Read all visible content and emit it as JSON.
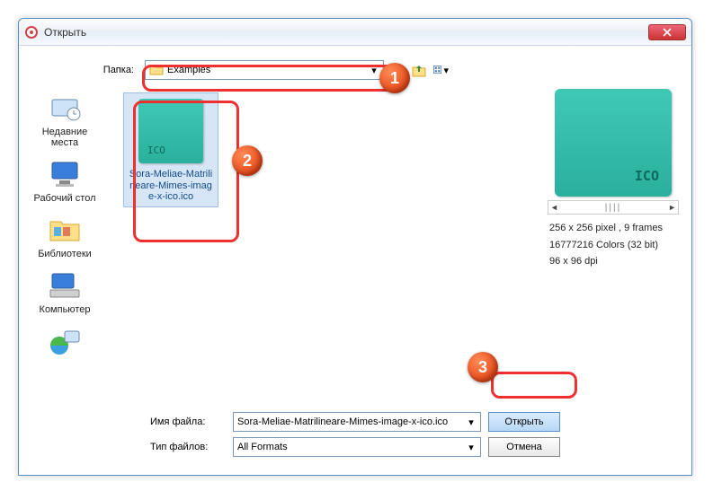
{
  "window": {
    "title": "Открыть"
  },
  "folder_row": {
    "label": "Папка:",
    "value": "Examples"
  },
  "sidebar": {
    "items": [
      {
        "label": "Недавние места"
      },
      {
        "label": "Рабочий стол"
      },
      {
        "label": "Библиотеки"
      },
      {
        "label": "Компьютер"
      },
      {
        "label": ""
      }
    ]
  },
  "file": {
    "name": "Sora-Meliae-Matrilineare-Mimes-image-x-ico.ico"
  },
  "preview": {
    "line1": "256 x 256 pixel , 9 frames",
    "line2": "16777216 Colors (32 bit)",
    "line3": "96 x 96 dpi"
  },
  "bottom": {
    "filename_label": "Имя файла:",
    "filename_value": "Sora-Meliae-Matrilineare-Mimes-image-x-ico.ico",
    "type_label": "Тип файлов:",
    "type_value": "All Formats",
    "open": "Открыть",
    "cancel": "Отмена"
  },
  "callouts": {
    "c1": "1",
    "c2": "2",
    "c3": "3"
  }
}
